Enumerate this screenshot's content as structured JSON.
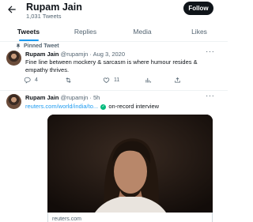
{
  "header": {
    "title": "Rupam Jain",
    "subtitle": "1,031 Tweets",
    "follow_label": "Follow"
  },
  "tabs": [
    {
      "label": "Tweets",
      "active": true
    },
    {
      "label": "Replies",
      "active": false
    },
    {
      "label": "Media",
      "active": false
    },
    {
      "label": "Likes",
      "active": false
    }
  ],
  "pinned": {
    "label": "Pinned Tweet",
    "name": "Rupam Jain",
    "meta": "@rupamjn · Aug 3, 2020",
    "text": "Fine line between mockery & sarcasm is where humour resides & empathy thrives.",
    "replies": "4",
    "likes": "11"
  },
  "tweet2": {
    "name": "Rupam Jain",
    "meta": "@rupamjn · 5h",
    "link": "reuters.com/world/india/to...",
    "text_after_link": "on-record interview",
    "verify_glyph": "✓",
    "card_source": "reuters.com"
  },
  "colors": {
    "accent": "#1d9bf0",
    "text": "#0f1419",
    "secondary": "#536471",
    "verified": "#00ba7c"
  }
}
